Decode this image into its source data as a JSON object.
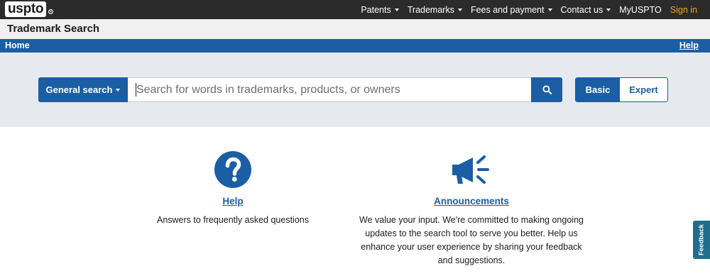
{
  "brand": {
    "logo_text": "uspto",
    "registered_mark": "R"
  },
  "topnav": {
    "items": [
      {
        "label": "Patents",
        "dropdown": true
      },
      {
        "label": "Trademarks",
        "dropdown": true
      },
      {
        "label": "Fees and payment",
        "dropdown": true
      },
      {
        "label": "Contact us",
        "dropdown": true
      },
      {
        "label": "MyUSPTO",
        "dropdown": false
      }
    ],
    "signin_label": "Sign in"
  },
  "titlebar": {
    "title": "Trademark Search"
  },
  "bluebar": {
    "home_label": "Home",
    "help_label": "Help"
  },
  "search": {
    "type_label": "General search",
    "placeholder": "Search for words in trademarks, products, or owners",
    "value": "",
    "modes": {
      "basic_label": "Basic",
      "expert_label": "Expert",
      "selected": "Basic"
    }
  },
  "cards": {
    "help": {
      "title": "Help",
      "description": "Answers to frequently asked questions",
      "icon": "question-circle-icon"
    },
    "announcements": {
      "title": "Announcements",
      "description": "We value your input. We're committed to making ongoing updates to the search tool to serve you better. Help us enhance your user experience by sharing your feedback and suggestions.",
      "icon": "megaphone-icon"
    }
  },
  "feedback": {
    "label": "Feedback"
  },
  "colors": {
    "primary": "#1b5ea4",
    "topbar": "#2b2b2b",
    "signin": "#f2a900",
    "band": "#e6e9ee",
    "feedback": "#1f6e8c"
  }
}
